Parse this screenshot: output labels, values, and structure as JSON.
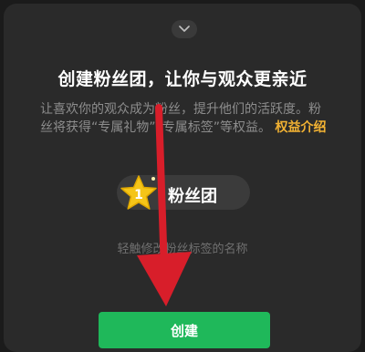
{
  "title": "创建粉丝团，让你与观众更亲近",
  "description": {
    "text": "让喜欢你的观众成为粉丝，提升他们的活跃度。粉丝将获得“专属礼物”“专属标签”等权益。",
    "link": "权益介绍"
  },
  "badge": {
    "level": "1",
    "label": "粉丝团"
  },
  "hint": "轻触修改粉丝标签的名称",
  "create_button": "创建",
  "icons": {
    "collapse": "chevron-down-icon",
    "badge_star": "star-badge-icon",
    "overlay_arrow": "red-arrow-annotation"
  },
  "colors": {
    "accent_link": "#f2b233",
    "primary_button": "#1fb85a",
    "arrow": "#d81e2a",
    "star": "#f5c518"
  }
}
